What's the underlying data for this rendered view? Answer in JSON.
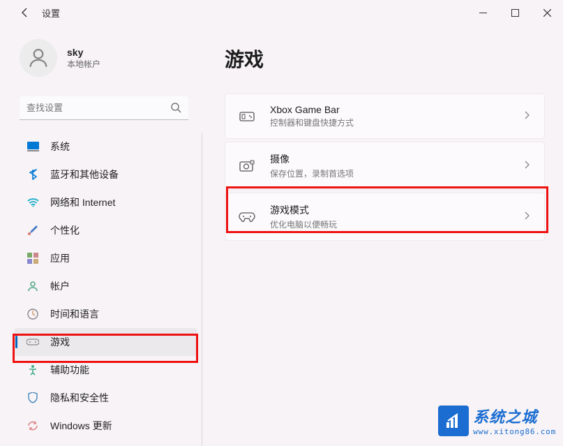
{
  "titlebar": {
    "app_title": "设置"
  },
  "user": {
    "name": "sky",
    "subtitle": "本地帐户"
  },
  "search": {
    "placeholder": "查找设置"
  },
  "sidebar": {
    "items": [
      {
        "label": "系统"
      },
      {
        "label": "蓝牙和其他设备"
      },
      {
        "label": "网络和 Internet"
      },
      {
        "label": "个性化"
      },
      {
        "label": "应用"
      },
      {
        "label": "帐户"
      },
      {
        "label": "时间和语言"
      },
      {
        "label": "游戏"
      },
      {
        "label": "辅助功能"
      },
      {
        "label": "隐私和安全性"
      },
      {
        "label": "Windows 更新"
      }
    ]
  },
  "main": {
    "title": "游戏",
    "cards": [
      {
        "title": "Xbox Game Bar",
        "sub": "控制器和键盘快捷方式"
      },
      {
        "title": "摄像",
        "sub": "保存位置，录制首选项"
      },
      {
        "title": "游戏模式",
        "sub": "优化电脑以便畅玩"
      }
    ]
  },
  "watermark": {
    "brand": "系统之城",
    "url": "www.xitong86.com"
  }
}
